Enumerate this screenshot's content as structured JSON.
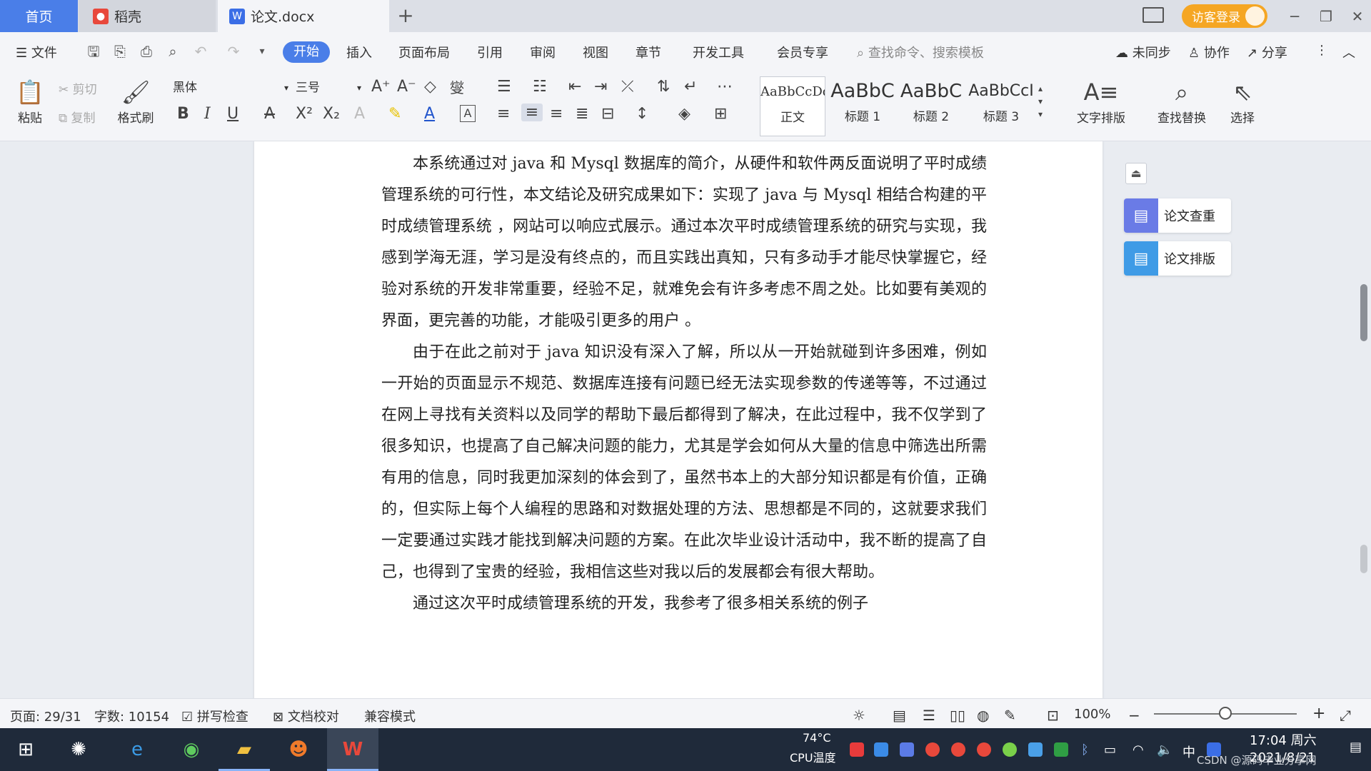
{
  "tabs": {
    "home": "首页",
    "daoke": "稻壳",
    "doc": "论文.docx",
    "add": "+"
  },
  "titlebar": {
    "login": "访客登录"
  },
  "menu": {
    "file": "文件",
    "items": [
      "开始",
      "插入",
      "页面布局",
      "引用",
      "审阅",
      "视图",
      "章节",
      "开发工具",
      "会员专享"
    ],
    "search_placeholder": "查找命令、搜索模板",
    "sync": "未同步",
    "collab": "协作",
    "share": "分享"
  },
  "ribbon": {
    "paste": "粘贴",
    "cut": "剪切",
    "copy": "复制",
    "format_painter": "格式刷",
    "font_name": "黑体",
    "font_size": "三号",
    "styles": [
      {
        "sample": "AaBbCcDd",
        "label": "正文"
      },
      {
        "sample": "AaBbC",
        "label": "标题 1"
      },
      {
        "sample": "AaBbC",
        "label": "标题 2"
      },
      {
        "sample": "AaBbCcI",
        "label": "标题 3"
      }
    ],
    "text_layout": "文字排版",
    "find_replace": "查找替换",
    "select": "选择"
  },
  "document": {
    "paragraphs": [
      "本系统通过对 java 和 Mysql 数据库的简介，从硬件和软件两反面说明了平时成绩管理系统的可行性，本文结论及研究成果如下：实现了 java 与 Mysql 相结合构建的平时成绩管理系统 ，网站可以响应式展示。通过本次平时成绩管理系统的研究与实现，我感到学海无涯，学习是没有终点的，而且实践出真知，只有多动手才能尽快掌握它，经验对系统的开发非常重要，经验不足，就难免会有许多考虑不周之处。比如要有美观的界面，更完善的功能，才能吸引更多的用户 。",
      "由于在此之前对于 java 知识没有深入了解，所以从一开始就碰到许多困难，例如一开始的页面显示不规范、数据库连接有问题已经无法实现参数的传递等等，不过通过在网上寻找有关资料以及同学的帮助下最后都得到了解决，在此过程中，我不仅学到了很多知识，也提高了自己解决问题的能力，尤其是学会如何从大量的信息中筛选出所需有用的信息，同时我更加深刻的体会到了，虽然书本上的大部分知识都是有价值，正确的，但实际上每个人编程的思路和对数据处理的方法、思想都是不同的，这就要求我们一定要通过实践才能找到解决问题的方案。在此次毕业设计活动中，我不断的提高了自己，也得到了宝贵的经验，我相信这些对我以后的发展都会有很大帮助。",
      "通过这次平时成绩管理系统的开发，我参考了很多相关系统的例子"
    ]
  },
  "side_panel": {
    "check": "论文查重",
    "layout": "论文排版"
  },
  "status": {
    "page": "页面: 29/31",
    "words": "字数: 10154",
    "spell": "拼写检查",
    "proof": "文档校对",
    "compat": "兼容模式",
    "zoom": "100%"
  },
  "taskbar": {
    "cpu_temp": "74°C",
    "cpu_label": "CPU温度",
    "ime": "中",
    "time": "17:04 周六",
    "date": "2021/8/21",
    "watermark": "CSDN @源码毕业分享网"
  },
  "colors": {
    "accent": "#4a7ee8",
    "login": "#f5a623",
    "taskbar": "#1f2a3a"
  }
}
